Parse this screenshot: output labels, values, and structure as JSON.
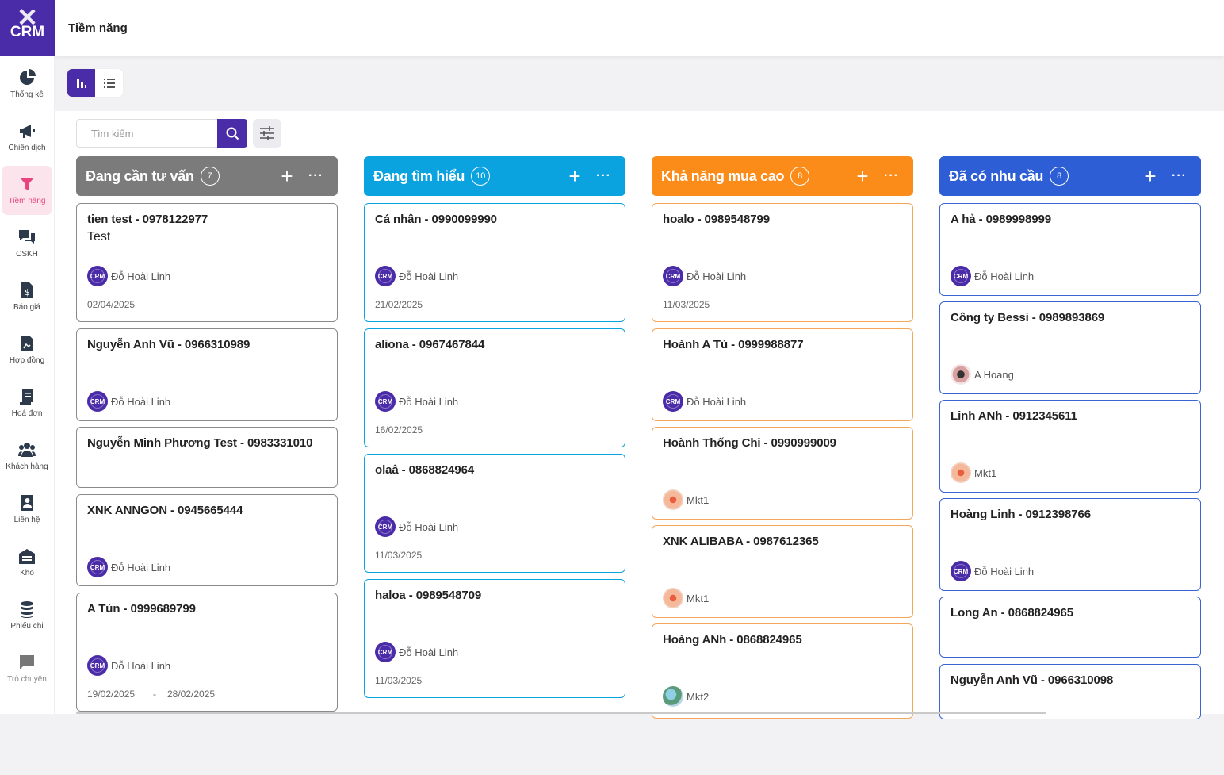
{
  "app": {
    "logo_text": "CRM",
    "page_title": "Tiềm năng"
  },
  "sidebar": {
    "items": [
      {
        "label": "Thống kê",
        "icon": "pie-chart-icon"
      },
      {
        "label": "Chiến dịch",
        "icon": "megaphone-icon"
      },
      {
        "label": "Tiềm năng",
        "icon": "filter-icon",
        "active": true
      },
      {
        "label": "CSKH",
        "icon": "chat-icon"
      },
      {
        "label": "Báo giá",
        "icon": "dollar-document-icon"
      },
      {
        "label": "Hợp đồng",
        "icon": "contract-icon"
      },
      {
        "label": "Hoá đơn",
        "icon": "invoice-icon"
      },
      {
        "label": "Khách hàng",
        "icon": "users-icon"
      },
      {
        "label": "Liên hệ",
        "icon": "contact-book-icon"
      },
      {
        "label": "Kho",
        "icon": "warehouse-icon"
      },
      {
        "label": "Phiếu chi",
        "icon": "coins-icon"
      },
      {
        "label": "Trò chuyện",
        "icon": "message-icon"
      }
    ]
  },
  "toolbar": {
    "search_placeholder": "Tìm kiếm"
  },
  "colors": {
    "accent": "#4a2ba8",
    "active_nav": "#e8457f"
  },
  "columns": [
    {
      "title": "Đang cần tư vấn",
      "count": "7",
      "color": "#7b7b7b",
      "border": "#8a8a8a",
      "cards": [
        {
          "name": "tien test - 0978122977",
          "note": "Test",
          "owner": "Đỗ Hoài Linh",
          "avatar": "crm",
          "date": "02/04/2025"
        },
        {
          "name": "Nguyễn Anh Vũ - 0966310989",
          "owner": "Đỗ Hoài Linh",
          "avatar": "crm"
        },
        {
          "name": "Nguyễn Minh Phương Test - 0983331010"
        },
        {
          "name": "XNK ANNGON - 0945665444",
          "owner": "Đỗ Hoài Linh",
          "avatar": "crm"
        },
        {
          "name": "A Tún - 0999689799",
          "owner": "Đỗ Hoài Linh",
          "avatar": "crm",
          "date": "19/02/2025",
          "date_sep": "-",
          "date_end": "28/02/2025"
        }
      ]
    },
    {
      "title": "Đang tìm hiểu",
      "count": "10",
      "color": "#0ba2e0",
      "border": "#0ba2e0",
      "cards": [
        {
          "name": "Cá nhân - 0990099990",
          "owner": "Đỗ Hoài Linh",
          "avatar": "crm",
          "date": "21/02/2025"
        },
        {
          "name": "aliona - 0967467844",
          "owner": "Đỗ Hoài Linh",
          "avatar": "crm",
          "date": "16/02/2025"
        },
        {
          "name": "olaâ - 0868824964",
          "owner": "Đỗ Hoài Linh",
          "avatar": "crm",
          "date": "11/03/2025"
        },
        {
          "name": "haloa - 0989548709",
          "owner": "Đỗ Hoài Linh",
          "avatar": "crm",
          "date": "11/03/2025"
        }
      ]
    },
    {
      "title": "Khả năng mua cao",
      "count": "8",
      "color": "#fb8c1a",
      "border": "#f4a65a",
      "cards": [
        {
          "name": "hoalo - 0989548799",
          "owner": "Đỗ Hoài Linh",
          "avatar": "crm",
          "date": "11/03/2025"
        },
        {
          "name": "Hoành A Tú - 0999988877",
          "owner": "Đỗ Hoài Linh",
          "avatar": "crm"
        },
        {
          "name": "Hoành Thống Chi - 0990999009",
          "owner": "Mkt1",
          "avatar": "mkt1"
        },
        {
          "name": "XNK ALIBABA - 0987612365",
          "owner": "Mkt1",
          "avatar": "mkt1"
        },
        {
          "name": "Hoàng ANh - 0868824965",
          "owner": "Mkt2",
          "avatar": "mkt2"
        }
      ]
    },
    {
      "title": "Đã có nhu cầu",
      "count": "8",
      "color": "#2e5ed6",
      "border": "#3b63d3",
      "cards": [
        {
          "name": "A hả - 0989998999",
          "owner": "Đỗ Hoài Linh",
          "avatar": "crm"
        },
        {
          "name": "Công ty Bessi - 0989893869",
          "owner": "A Hoang",
          "avatar": "hoang"
        },
        {
          "name": "Linh ANh - 0912345611",
          "owner": "Mkt1",
          "avatar": "mkt1"
        },
        {
          "name": "Hoàng Linh - 0912398766",
          "owner": "Đỗ Hoài Linh",
          "avatar": "crm"
        },
        {
          "name": "Long An - 0868824965"
        },
        {
          "name": "Nguyễn Anh Vũ - 0966310098"
        }
      ]
    }
  ]
}
